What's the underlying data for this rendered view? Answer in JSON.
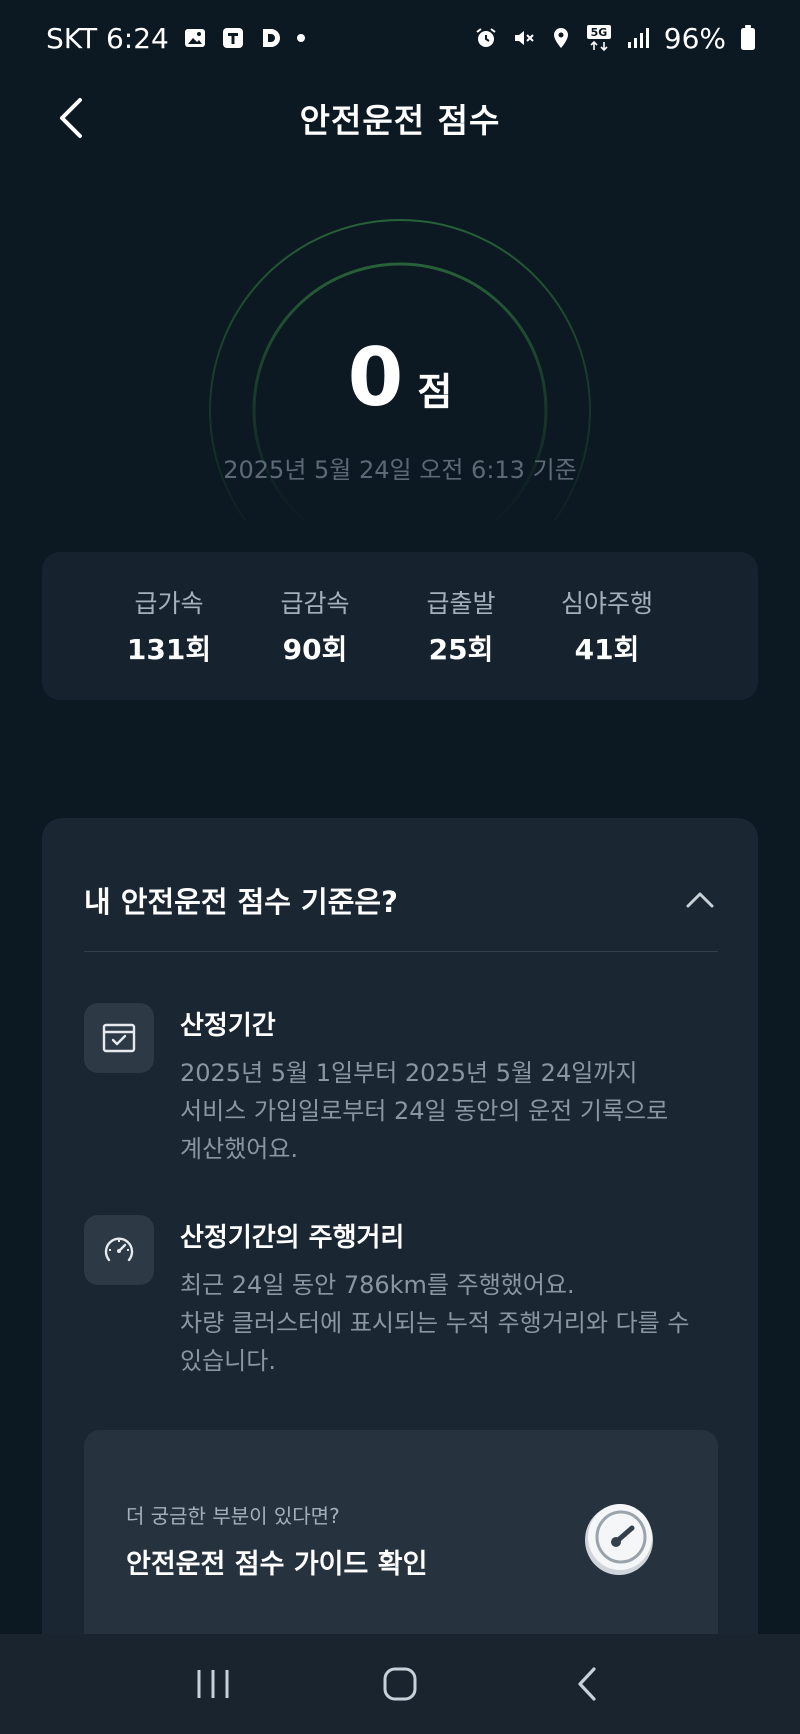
{
  "status_bar": {
    "carrier_time": "SKT 6:24",
    "battery": "96%",
    "left_icons": [
      "gallery-icon",
      "t-app-icon",
      "d-app-icon",
      "notification-dot-icon"
    ],
    "right_icons": [
      "alarm-icon",
      "mute-icon",
      "location-icon",
      "5g-icon",
      "signal-icon",
      "battery-icon"
    ]
  },
  "header": {
    "title": "안전운전 점수"
  },
  "score": {
    "value": "0",
    "unit": "점",
    "as_of": "2025년 5월 24일 오전 6:13 기준"
  },
  "stats": [
    {
      "label": "급가속",
      "value": "131회"
    },
    {
      "label": "급감속",
      "value": "90회"
    },
    {
      "label": "급출발",
      "value": "25회"
    },
    {
      "label": "심야주행",
      "value": "41회"
    }
  ],
  "criteria": {
    "title": "내 안전운전 점수 기준은?",
    "items": [
      {
        "title": "산정기간",
        "lines": [
          "2025년 5월 1일부터 2025년 5월 24일까지",
          "서비스 가입일로부터 24일 동안의 운전 기록으로",
          "계산했어요."
        ]
      },
      {
        "title": "산정기간의 주행거리",
        "lines": [
          "최근 24일 동안 786km를 주행했어요.",
          "차량 클러스터에 표시되는 누적 주행거리와 다를 수",
          "있습니다."
        ]
      }
    ]
  },
  "guide": {
    "subtitle": "더 궁금한 부분이 있다면?",
    "title": "안전운전 점수 가이드 확인"
  },
  "colors": {
    "background": "#0c1822",
    "card": "#16232f",
    "ring": "#1f4a2c",
    "muted_text": "#8a96a2"
  }
}
